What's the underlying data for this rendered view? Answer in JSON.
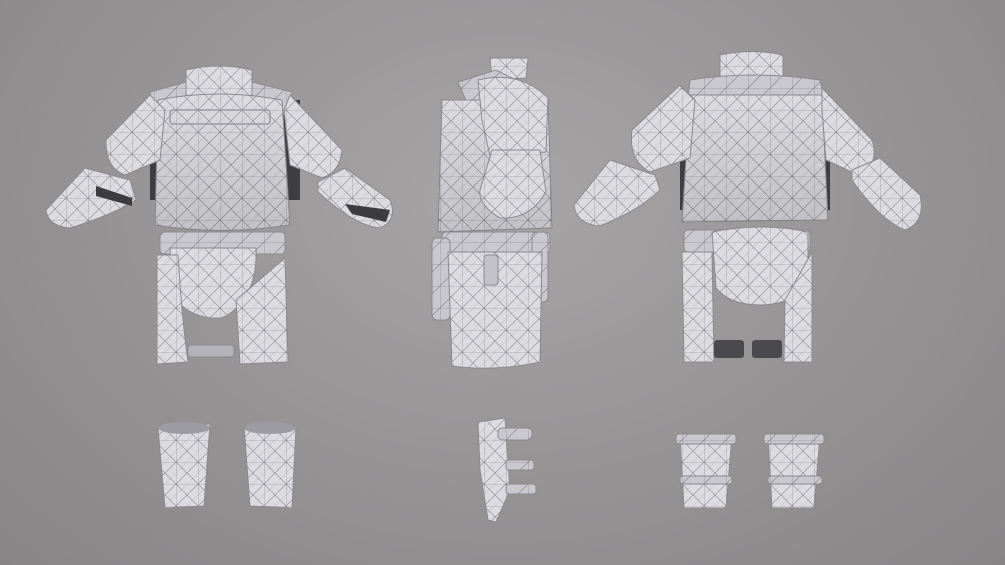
{
  "scene": {
    "views": [
      "front",
      "side",
      "back"
    ],
    "render_style": "wireframe-on-shaded clay model",
    "colors": {
      "background": "#979596",
      "clay": "#dedde2",
      "clay_shade": "#c4c3c8",
      "wire": "#6b6a70",
      "shadow": "#3c3b40"
    }
  }
}
